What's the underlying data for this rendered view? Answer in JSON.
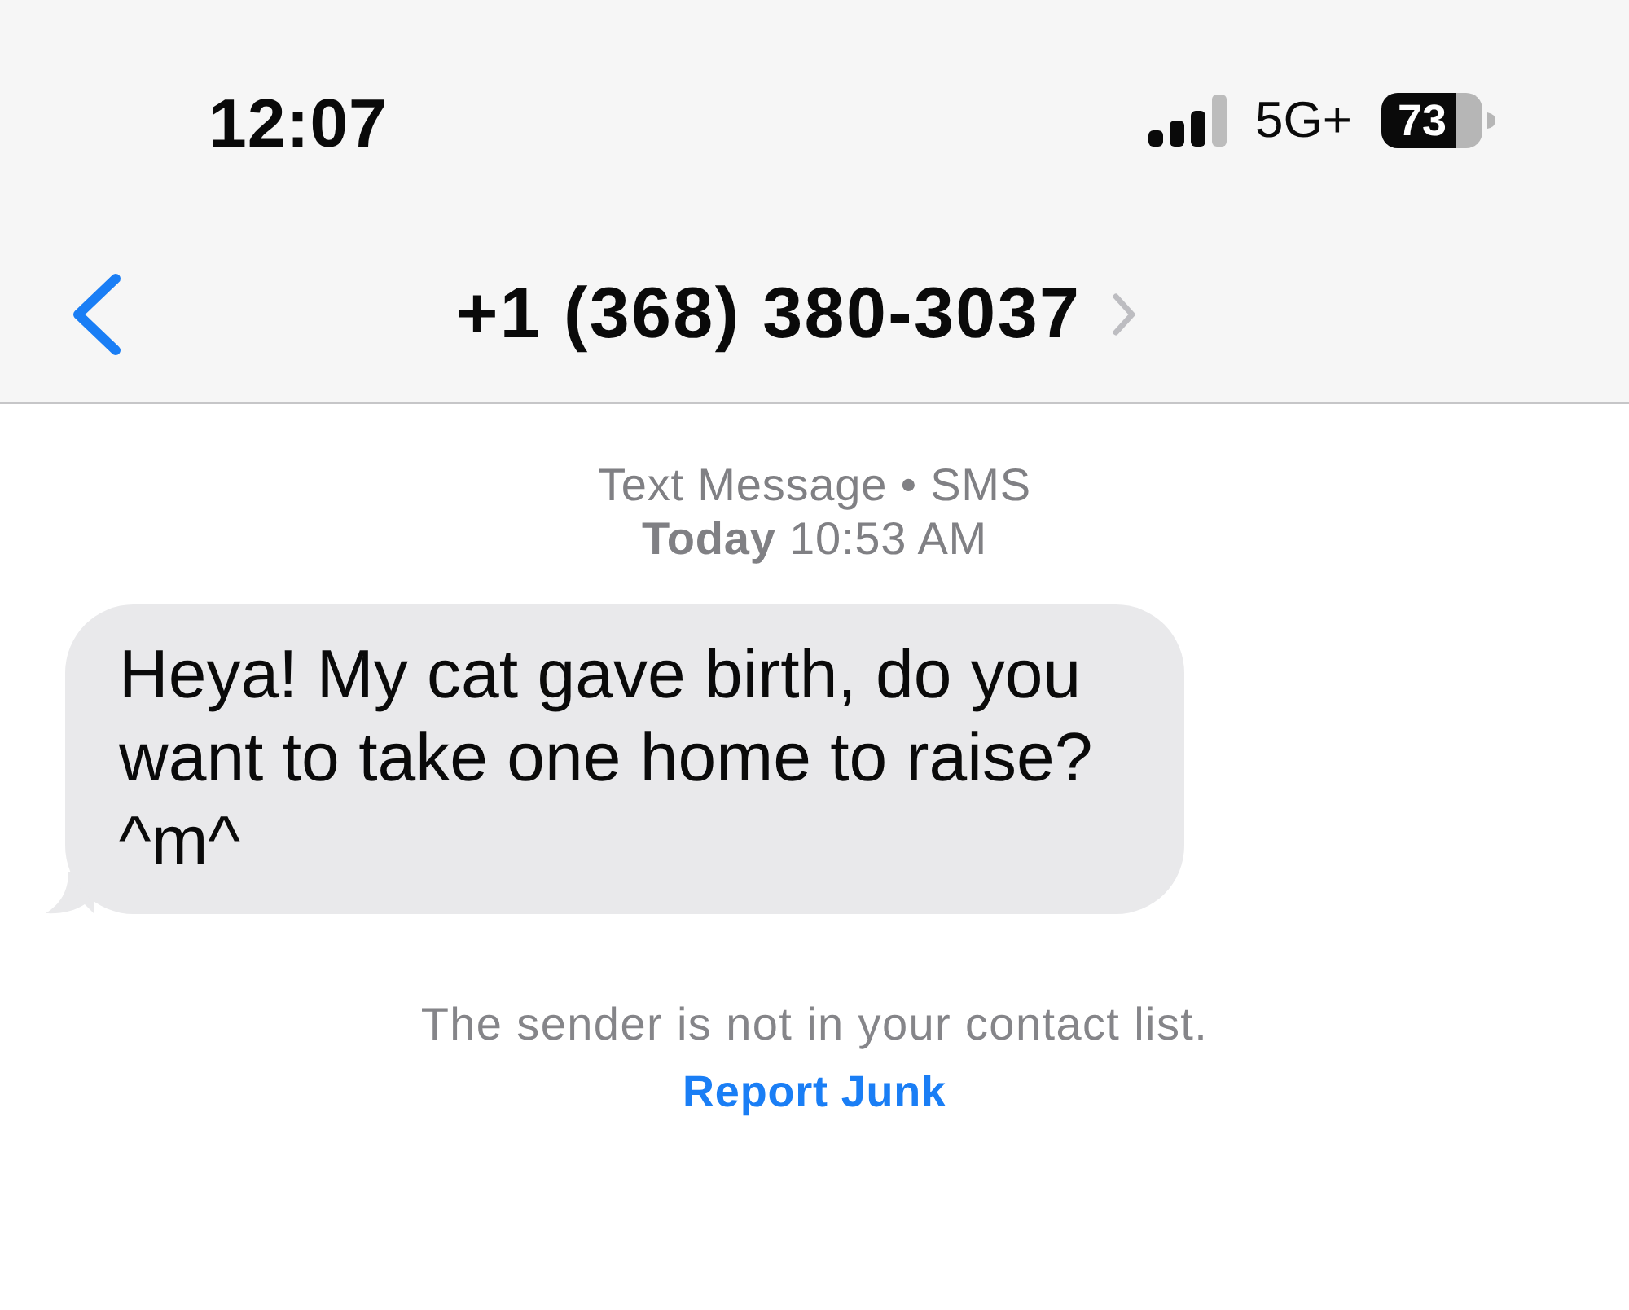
{
  "status_bar": {
    "time": "12:07",
    "network": "5G+",
    "battery": "73"
  },
  "nav": {
    "title": "+1 (368) 380-3037"
  },
  "conversation": {
    "service": "Text Message • SMS",
    "timestamp": "**Today** 10:53 AM",
    "messages": [
      {
        "kind": "incoming",
        "text": "Heya! My cat gave birth, do you want to take one home to raise? ^m^"
      }
    ],
    "notice": "The sender is not in your contact list.",
    "action": "Report Junk"
  }
}
